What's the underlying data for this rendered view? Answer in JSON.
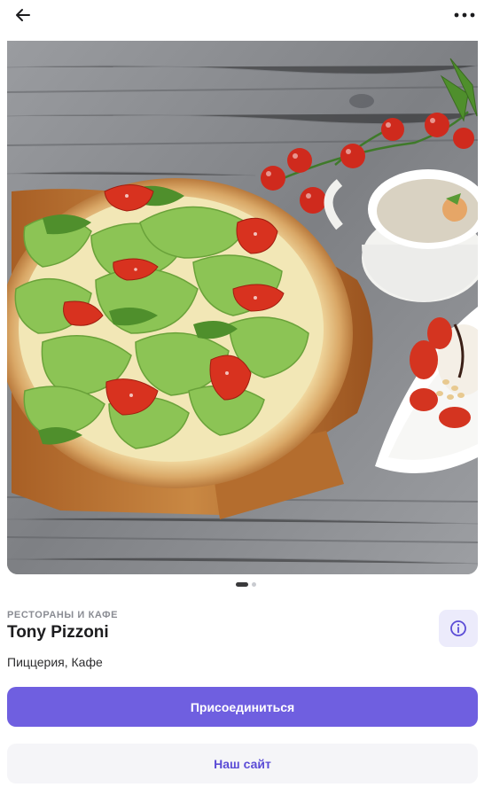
{
  "header": {
    "back_icon": "arrow-left-icon",
    "more_icon": "more-horizontal-icon"
  },
  "gallery": {
    "image_subject": "pizza-with-salad-tomatoes-soup-photo",
    "page_count": 2,
    "active_index": 0
  },
  "venue": {
    "category": "РЕСТОРАНЫ И КАФЕ",
    "name": "Tony Pizzoni",
    "tags": "Пиццерия, Кафе",
    "info_icon": "info-icon"
  },
  "actions": {
    "join_label": "Присоединиться",
    "site_label": "Наш сайт"
  },
  "colors": {
    "accent": "#6f5fe0",
    "accent_soft": "#ecebfb",
    "secondary_button": "#f5f5f8"
  }
}
